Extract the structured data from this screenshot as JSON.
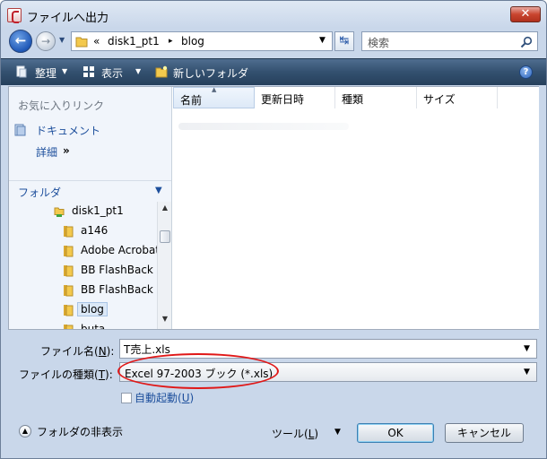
{
  "window": {
    "title": "ファイルへ出力",
    "close_label": "✕"
  },
  "address": {
    "overflow": "«",
    "crumbs": [
      "disk1_pt1",
      "blog"
    ],
    "separator": "▸"
  },
  "search": {
    "placeholder": "検索"
  },
  "toolbar": {
    "organize_label": "整理",
    "views_label": "表示",
    "new_folder_label": "新しいフォルダ",
    "help_label": "?"
  },
  "nav": {
    "favorites_header": "お気に入りリンク",
    "favorites": [
      {
        "label": "ドキュメント",
        "icon": "document-icon"
      }
    ],
    "details_label": "詳細",
    "details_chevron": "»",
    "folders_label": "フォルダ",
    "folders_chevron": "⌄",
    "tree": [
      {
        "label": "disk1_pt1",
        "icon": "drive-icon"
      },
      {
        "label": "a146",
        "icon": "folder-icon"
      },
      {
        "label": "Adobe Acrobat",
        "icon": "folder-icon"
      },
      {
        "label": "BB FlashBack",
        "icon": "folder-icon"
      },
      {
        "label": "BB FlashBack",
        "icon": "folder-icon"
      },
      {
        "label": "blog",
        "icon": "folder-icon",
        "selected": true
      },
      {
        "label": "buta",
        "icon": "folder-icon"
      }
    ]
  },
  "columns": [
    "名前",
    "更新日時",
    "種類",
    "サイズ"
  ],
  "form": {
    "filename_label": "ファイル名(",
    "filename_key": "N",
    "filename_suffix": "):",
    "filename_value": "T売上.xls",
    "filetype_label": "ファイルの種類(",
    "filetype_key": "T",
    "filetype_suffix": "):",
    "filetype_value": "Excel 97-2003 ブック (*.xls)",
    "autostart_label": "自動起動(",
    "autostart_key": "U",
    "autostart_suffix": ")",
    "autostart_checked": false
  },
  "footer": {
    "hide_folders_label": "フォルダの非表示",
    "tools_label": "ツール(",
    "tools_key": "L",
    "tools_suffix": ")",
    "ok_label": "OK",
    "cancel_label": "キャンセル"
  },
  "colors": {
    "annotation_ellipse": "#e01818",
    "toolbar": "#33506f",
    "link": "#1d4f9c"
  }
}
